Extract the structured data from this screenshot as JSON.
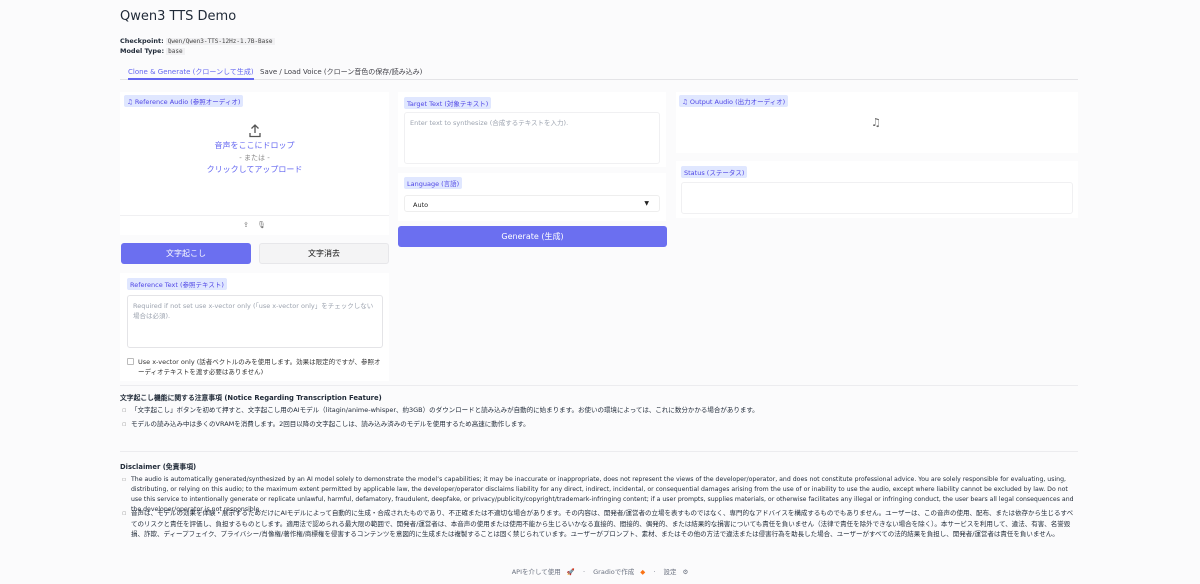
{
  "app": {
    "title": "Qwen3 TTS Demo"
  },
  "meta": {
    "checkpoint_label": "Checkpoint:",
    "checkpoint_value": "Qwen/Qwen3-TTS-12Hz-1.7B-Base",
    "model_type_label": "Model Type:",
    "model_type_value": "base"
  },
  "tabs": [
    {
      "label": "Clone & Generate (クローンして生成)",
      "active": true
    },
    {
      "label": "Save / Load Voice (クローン音色の保存/読み込み)",
      "active": false
    }
  ],
  "reference_audio": {
    "label": "Reference Audio (参照オーディオ)",
    "drop_text": "音声をここにドロップ",
    "or_text": "- または -",
    "click_text": "クリックしてアップロード"
  },
  "buttons": {
    "transcribe": "文字起こし",
    "clear": "文字消去",
    "generate": "Generate (生成)"
  },
  "reference_text": {
    "label": "Reference Text (参照テキスト)",
    "placeholder": "Required if not set use x-vector only (「use x-vector only」をチェックしない場合は必須)."
  },
  "xvector": {
    "label": "Use x-vector only (話者ベクトルのみを使用します。効果は限定的ですが、参照オーディオテキストを渡す必要はありません)",
    "checked": false
  },
  "target_text": {
    "label": "Target Text (対象テキスト)",
    "placeholder": "Enter text to synthesize (合成するテキストを入力)."
  },
  "language": {
    "label": "Language (言語)",
    "value": "Auto"
  },
  "output_audio": {
    "label": "Output Audio (出力オーディオ)"
  },
  "status": {
    "label": "Status (ステータス)",
    "value": ""
  },
  "notice": {
    "title": "文字起こし機能に関する注意事項 (Notice Regarding Transcription Feature)",
    "items": [
      "「文字起こし」ボタンを初めて押すと、文字起こし用のAIモデル（litagin/anime-whisper、約3GB）のダウンロードと読み込みが自動的に始まります。お使いの環境によっては、これに数分かかる場合があります。",
      "モデルの読み込み中は多くのVRAMを消費します。2回目以降の文字起こしは、読み込み済みのモデルを使用するため高速に動作します。"
    ]
  },
  "disclaimer": {
    "title": "Disclaimer (免責事項)",
    "items": [
      "The audio is automatically generated/synthesized by an AI model solely to demonstrate the model’s capabilities; it may be inaccurate or inappropriate, does not represent the views of the developer/operator, and does not constitute professional advice. You are solely responsible for evaluating, using, distributing, or relying on this audio; to the maximum extent permitted by applicable law, the developer/operator disclaims liability for any direct, indirect, incidental, or consequential damages arising from the use of or inability to use the audio, except where liability cannot be excluded by law. Do not use this service to intentionally generate or replicate unlawful, harmful, defamatory, fraudulent, deepfake, or privacy/publicity/copyright/trademark-infringing content; if a user prompts, supplies materials, or otherwise facilitates any illegal or infringing conduct, the user bears all legal consequences and the developer/operator is not responsible.",
      "音声は、モデルの効果を体験・展示するためだけにAIモデルによって自動的に生成・合成されたものであり、不正確または不適切な場合があります。その内容は、開発者/運営者の立場を表すものではなく、専門的なアドバイスを構成するものでもありません。ユーザーは、この音声の使用、配布、または依存から生じるすべてのリスクと責任を評価し、負担するものとします。適用法で認められる最大限の範囲で、開発者/運営者は、本音声の使用または使用不能から生じるいかなる直接的、間接的、偶発的、または結果的な損害についても責任を負いません（法律で責任を除外できない場合を除く）。本サービスを利用して、違法、有害、名誉毀損、詐欺、ディープフェイク、プライバシー/肖像権/著作権/商標権を侵害するコンテンツを意図的に生成または複製することは固く禁じられています。ユーザーがプロンプト、素材、またはその他の方法で違法または侵害行為を助長した場合、ユーザーがすべての法的結果を負担し、開発者/運営者は責任を負いません。"
    ]
  },
  "footer": {
    "api": "APIを介して使用",
    "gradio": "Gradioで作成",
    "settings": "設定"
  },
  "colors": {
    "accent": "#6b6ff0",
    "chip_bg": "#e0e7ff"
  }
}
